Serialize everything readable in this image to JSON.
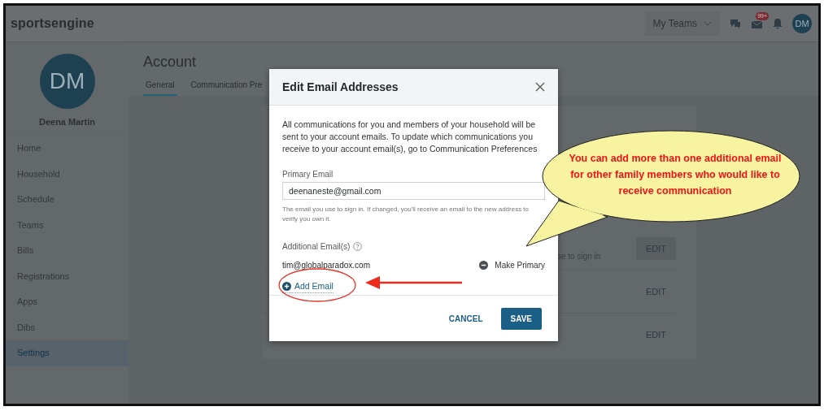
{
  "header": {
    "logo": "sportsengine",
    "teams_menu": "My Teams",
    "inbox_badge": "99+",
    "avatar": "DM"
  },
  "sidebar": {
    "avatar": "DM",
    "name": "Deena Martin",
    "items": [
      {
        "label": "Home",
        "selected": false
      },
      {
        "label": "Household",
        "selected": false
      },
      {
        "label": "Schedule",
        "selected": false
      },
      {
        "label": "Teams",
        "selected": false
      },
      {
        "label": "Bills",
        "selected": false
      },
      {
        "label": "Registrations",
        "selected": false
      },
      {
        "label": "Apps",
        "selected": false
      },
      {
        "label": "Dibs",
        "selected": false
      },
      {
        "label": "Settings",
        "selected": true
      }
    ]
  },
  "main": {
    "title": "Account",
    "tabs": [
      {
        "label": "General",
        "selected": true
      },
      {
        "label": "Communication Pre",
        "selected": false
      }
    ],
    "card_rows": [
      {
        "text": "se to sign in",
        "button": "EDIT"
      },
      {
        "button": "EDIT"
      },
      {
        "button": "EDIT"
      }
    ]
  },
  "modal": {
    "title": "Edit Email Addresses",
    "intro": "All communications for you and members of your household will be sent to your account emails. To update which communications you receive to your account email(s), go to Communication Preferences",
    "primary_label": "Primary Email",
    "primary_value": "deenaneste@gmail.com",
    "primary_hint": "The email you use to sign in. If changed, you'll receive an email to the new address to verify you own it.",
    "additional_label": "Additional Email(s)",
    "additional": [
      {
        "email": "tim@globalparadox.com",
        "action": "Make Primary"
      }
    ],
    "add_link": "Add Email",
    "buttons": [
      {
        "label": "CANCEL",
        "kind": "text"
      },
      {
        "label": "SAVE",
        "kind": "primary"
      }
    ]
  },
  "callout": {
    "text": "You can add more than one additional email for other family members who would like to receive communication"
  }
}
